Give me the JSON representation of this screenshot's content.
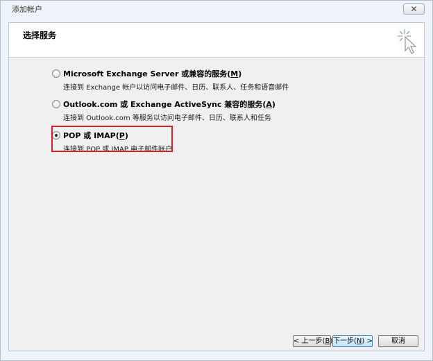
{
  "window": {
    "title": "添加帐户",
    "close_symbol": "✕"
  },
  "header": {
    "title": "选择服务",
    "icon": "wizard-sparkle-cursor-icon"
  },
  "options": [
    {
      "title_main": "Microsoft Exchange Server 或兼容的服务(",
      "hotkey": "M",
      "title_end": ")",
      "description": "连接到 Exchange 帐户以访问电子邮件、日历、联系人、任务和语音邮件",
      "checked": false
    },
    {
      "title_main": "Outlook.com 或 Exchange ActiveSync 兼容的服务(",
      "hotkey": "A",
      "title_end": ")",
      "description": "连接到 Outlook.com 等服务以访问电子邮件、日历、联系人和任务",
      "checked": false
    },
    {
      "title_main": "POP 或 IMAP(",
      "hotkey": "P",
      "title_end": ")",
      "description": "连接到 POP 或 IMAP 电子邮件帐户",
      "checked": true
    }
  ],
  "buttons": {
    "back": {
      "label_pre": "< 上一步(",
      "hotkey": "B",
      "label_post": ")"
    },
    "next": {
      "label_pre": "下一步(",
      "hotkey": "N",
      "label_post": ") >"
    },
    "cancel": "取消"
  },
  "colors": {
    "highlight_border": "#d81f25",
    "panel_bg": "#f0f0f0",
    "window_bg": "#eef4fa"
  }
}
